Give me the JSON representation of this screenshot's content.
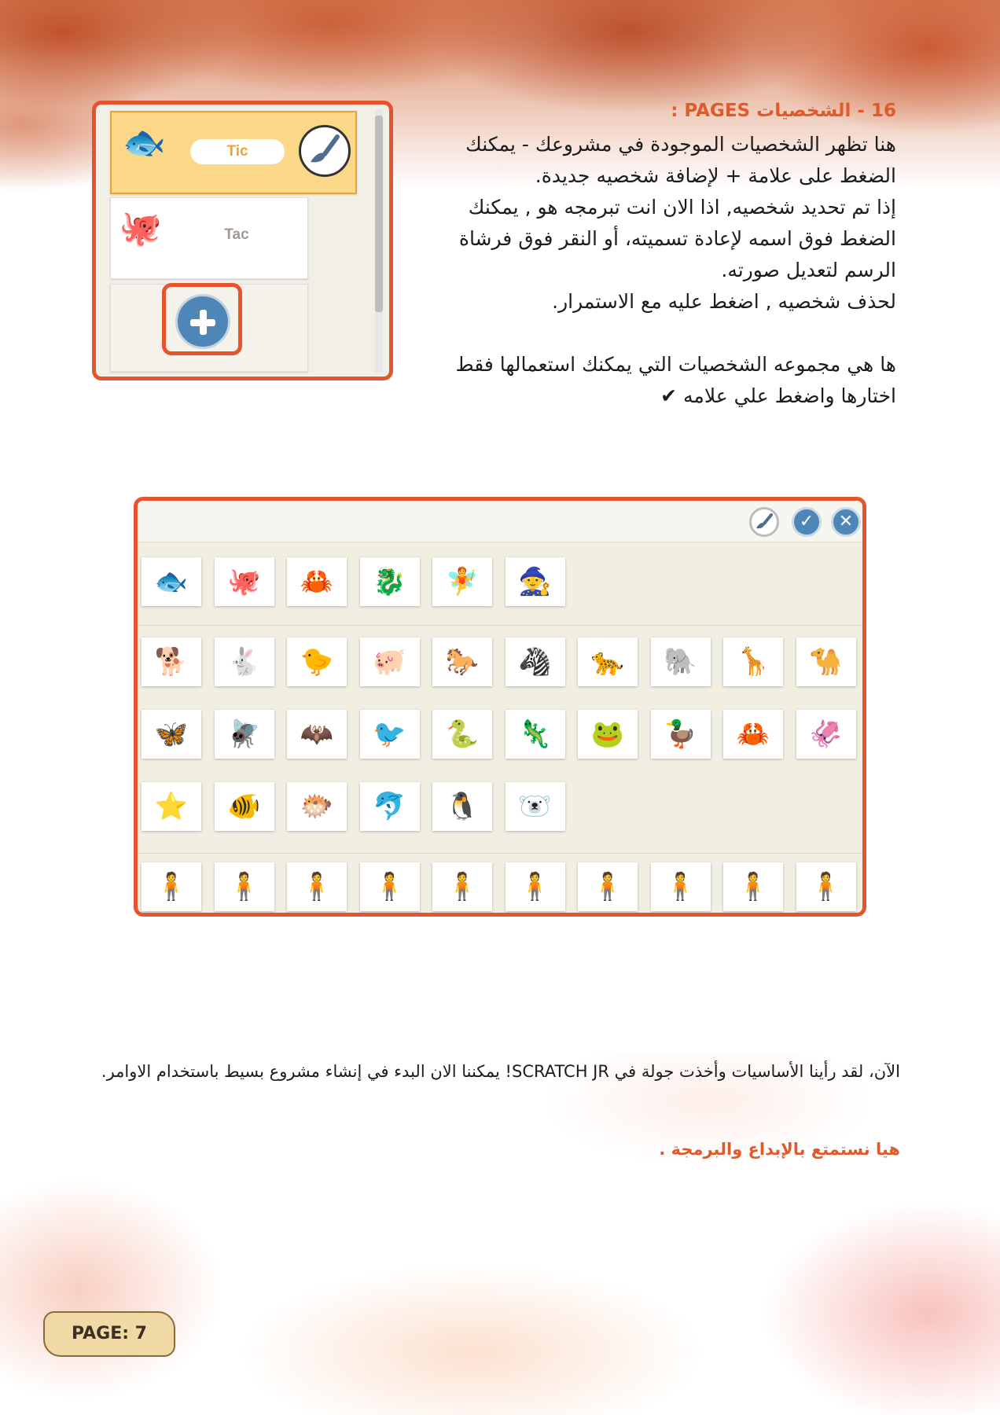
{
  "sprite_panel": {
    "sprites": [
      {
        "name": "Tic",
        "emoji": "🐟"
      },
      {
        "name": "Tac",
        "emoji": "🐙"
      }
    ]
  },
  "heading": "16 - الشخصيات PAGES :",
  "paragraphs": [
    "هنا تظهر  الشخصيات الموجودة في مشروعك - يمكنك الضغط على علامة + لإضافة شخصيه جديدة.",
    " إذا تم تحديد شخصيه, اذا الان انت تبرمجه هو , يمكنك الضغط فوق اسمه لإعادة تسميته، أو النقر فوق فرشاة الرسم لتعديل صورته.",
    "لحذف شخصيه , اضغط عليه مع الاستمرار.",
    "ها هي مجموعه الشخصيات التي يمكنك استعمالها فقط اختارها واضغط علي علامه ✔"
  ],
  "library": {
    "buttons": {
      "confirm": "✓",
      "cancel": "✕"
    },
    "rows": [
      [
        "🐟",
        "🐙",
        "🦀",
        "🐉",
        "🧚",
        "🧙"
      ],
      [
        "🐕",
        "🐇",
        "🐤",
        "🐖",
        "🐎",
        "🦓",
        "🐆",
        "🐘",
        "🦒",
        "🐪"
      ],
      [
        "🦋",
        "🪰",
        "🦇",
        "🐦",
        "🐍",
        "🦎",
        "🐸",
        "🦆",
        "🦀",
        "🦑"
      ],
      [
        "⭐",
        "🐠",
        "🐡",
        "🐬",
        "🐧",
        "🐻‍❄️"
      ],
      [
        "🧍",
        "🧍",
        "🧍",
        "🧍",
        "🧍",
        "🧍",
        "🧍",
        "🧍",
        "🧍",
        "🧍"
      ]
    ]
  },
  "outro": "الآن، لقد رأينا الأساسيات وأخذت جولة في SCRATCH JR! يمكننا الان البدء في إنشاء مشروع بسيط باستخدام الاوامر.",
  "closing": "هيا نستمتع بالإبداع والبرمجة .",
  "page_label": "PAGE: 7",
  "colors": {
    "accent": "#e5532f",
    "heading": "#e05a2a",
    "blue": "#4e86b8"
  }
}
